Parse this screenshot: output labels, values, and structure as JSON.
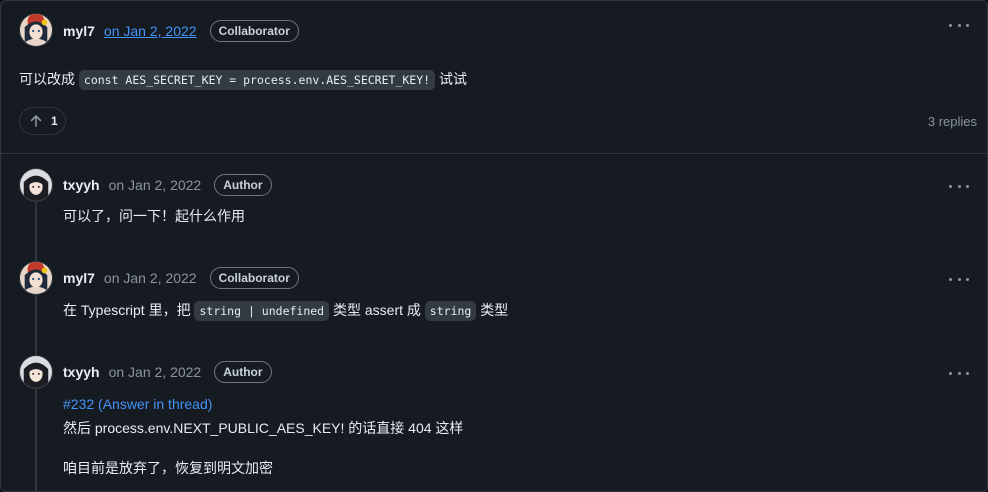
{
  "main_comment": {
    "author": "myl7",
    "date": "on Jan 2, 2022",
    "badge": "Collaborator",
    "text_before": "可以改成",
    "code": "const AES_SECRET_KEY = process.env.AES_SECRET_KEY!",
    "text_after": "试试",
    "upvotes": "1",
    "replies_count": "3 replies"
  },
  "replies": [
    {
      "author": "txyyh",
      "date": "on Jan 2, 2022",
      "badge": "Author",
      "text": "可以了，问一下！起什么作用"
    },
    {
      "author": "myl7",
      "date": "on Jan 2, 2022",
      "badge": "Collaborator",
      "text_1": "在 Typescript 里，把",
      "code_1": "string | undefined",
      "text_2": "类型 assert 成",
      "code_2": "string",
      "text_3": "类型"
    },
    {
      "author": "txyyh",
      "date": "on Jan 2, 2022",
      "badge": "Author",
      "link": "#232 (Answer in thread)",
      "line_1": "然后 process.env.NEXT_PUBLIC_AES_KEY! 的话直接 404 这样",
      "line_2": "咱目前是放弃了，恢复到明文加密"
    }
  ],
  "colors": {
    "background": "#161b22",
    "border": "#30363d",
    "link": "#4493f8",
    "muted": "#8b949e"
  }
}
